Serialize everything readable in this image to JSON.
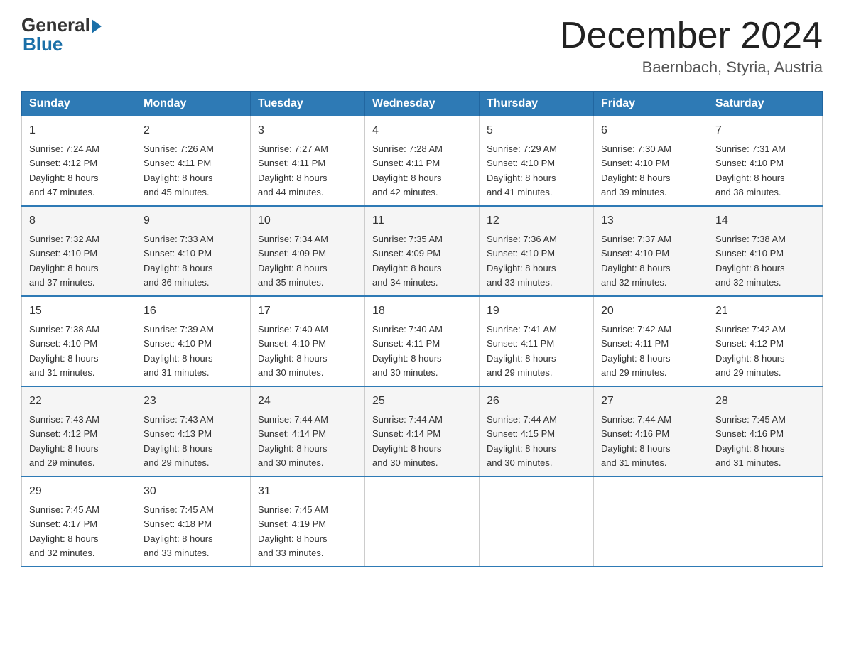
{
  "header": {
    "logo_general": "General",
    "logo_blue": "Blue",
    "month_title": "December 2024",
    "location": "Baernbach, Styria, Austria"
  },
  "weekdays": [
    "Sunday",
    "Monday",
    "Tuesday",
    "Wednesday",
    "Thursday",
    "Friday",
    "Saturday"
  ],
  "weeks": [
    [
      {
        "day": "1",
        "sunrise": "7:24 AM",
        "sunset": "4:12 PM",
        "daylight": "8 hours and 47 minutes."
      },
      {
        "day": "2",
        "sunrise": "7:26 AM",
        "sunset": "4:11 PM",
        "daylight": "8 hours and 45 minutes."
      },
      {
        "day": "3",
        "sunrise": "7:27 AM",
        "sunset": "4:11 PM",
        "daylight": "8 hours and 44 minutes."
      },
      {
        "day": "4",
        "sunrise": "7:28 AM",
        "sunset": "4:11 PM",
        "daylight": "8 hours and 42 minutes."
      },
      {
        "day": "5",
        "sunrise": "7:29 AM",
        "sunset": "4:10 PM",
        "daylight": "8 hours and 41 minutes."
      },
      {
        "day": "6",
        "sunrise": "7:30 AM",
        "sunset": "4:10 PM",
        "daylight": "8 hours and 39 minutes."
      },
      {
        "day": "7",
        "sunrise": "7:31 AM",
        "sunset": "4:10 PM",
        "daylight": "8 hours and 38 minutes."
      }
    ],
    [
      {
        "day": "8",
        "sunrise": "7:32 AM",
        "sunset": "4:10 PM",
        "daylight": "8 hours and 37 minutes."
      },
      {
        "day": "9",
        "sunrise": "7:33 AM",
        "sunset": "4:10 PM",
        "daylight": "8 hours and 36 minutes."
      },
      {
        "day": "10",
        "sunrise": "7:34 AM",
        "sunset": "4:09 PM",
        "daylight": "8 hours and 35 minutes."
      },
      {
        "day": "11",
        "sunrise": "7:35 AM",
        "sunset": "4:09 PM",
        "daylight": "8 hours and 34 minutes."
      },
      {
        "day": "12",
        "sunrise": "7:36 AM",
        "sunset": "4:10 PM",
        "daylight": "8 hours and 33 minutes."
      },
      {
        "day": "13",
        "sunrise": "7:37 AM",
        "sunset": "4:10 PM",
        "daylight": "8 hours and 32 minutes."
      },
      {
        "day": "14",
        "sunrise": "7:38 AM",
        "sunset": "4:10 PM",
        "daylight": "8 hours and 32 minutes."
      }
    ],
    [
      {
        "day": "15",
        "sunrise": "7:38 AM",
        "sunset": "4:10 PM",
        "daylight": "8 hours and 31 minutes."
      },
      {
        "day": "16",
        "sunrise": "7:39 AM",
        "sunset": "4:10 PM",
        "daylight": "8 hours and 31 minutes."
      },
      {
        "day": "17",
        "sunrise": "7:40 AM",
        "sunset": "4:10 PM",
        "daylight": "8 hours and 30 minutes."
      },
      {
        "day": "18",
        "sunrise": "7:40 AM",
        "sunset": "4:11 PM",
        "daylight": "8 hours and 30 minutes."
      },
      {
        "day": "19",
        "sunrise": "7:41 AM",
        "sunset": "4:11 PM",
        "daylight": "8 hours and 29 minutes."
      },
      {
        "day": "20",
        "sunrise": "7:42 AM",
        "sunset": "4:11 PM",
        "daylight": "8 hours and 29 minutes."
      },
      {
        "day": "21",
        "sunrise": "7:42 AM",
        "sunset": "4:12 PM",
        "daylight": "8 hours and 29 minutes."
      }
    ],
    [
      {
        "day": "22",
        "sunrise": "7:43 AM",
        "sunset": "4:12 PM",
        "daylight": "8 hours and 29 minutes."
      },
      {
        "day": "23",
        "sunrise": "7:43 AM",
        "sunset": "4:13 PM",
        "daylight": "8 hours and 29 minutes."
      },
      {
        "day": "24",
        "sunrise": "7:44 AM",
        "sunset": "4:14 PM",
        "daylight": "8 hours and 30 minutes."
      },
      {
        "day": "25",
        "sunrise": "7:44 AM",
        "sunset": "4:14 PM",
        "daylight": "8 hours and 30 minutes."
      },
      {
        "day": "26",
        "sunrise": "7:44 AM",
        "sunset": "4:15 PM",
        "daylight": "8 hours and 30 minutes."
      },
      {
        "day": "27",
        "sunrise": "7:44 AM",
        "sunset": "4:16 PM",
        "daylight": "8 hours and 31 minutes."
      },
      {
        "day": "28",
        "sunrise": "7:45 AM",
        "sunset": "4:16 PM",
        "daylight": "8 hours and 31 minutes."
      }
    ],
    [
      {
        "day": "29",
        "sunrise": "7:45 AM",
        "sunset": "4:17 PM",
        "daylight": "8 hours and 32 minutes."
      },
      {
        "day": "30",
        "sunrise": "7:45 AM",
        "sunset": "4:18 PM",
        "daylight": "8 hours and 33 minutes."
      },
      {
        "day": "31",
        "sunrise": "7:45 AM",
        "sunset": "4:19 PM",
        "daylight": "8 hours and 33 minutes."
      },
      null,
      null,
      null,
      null
    ]
  ],
  "labels": {
    "sunrise": "Sunrise: ",
    "sunset": "Sunset: ",
    "daylight": "Daylight: "
  }
}
